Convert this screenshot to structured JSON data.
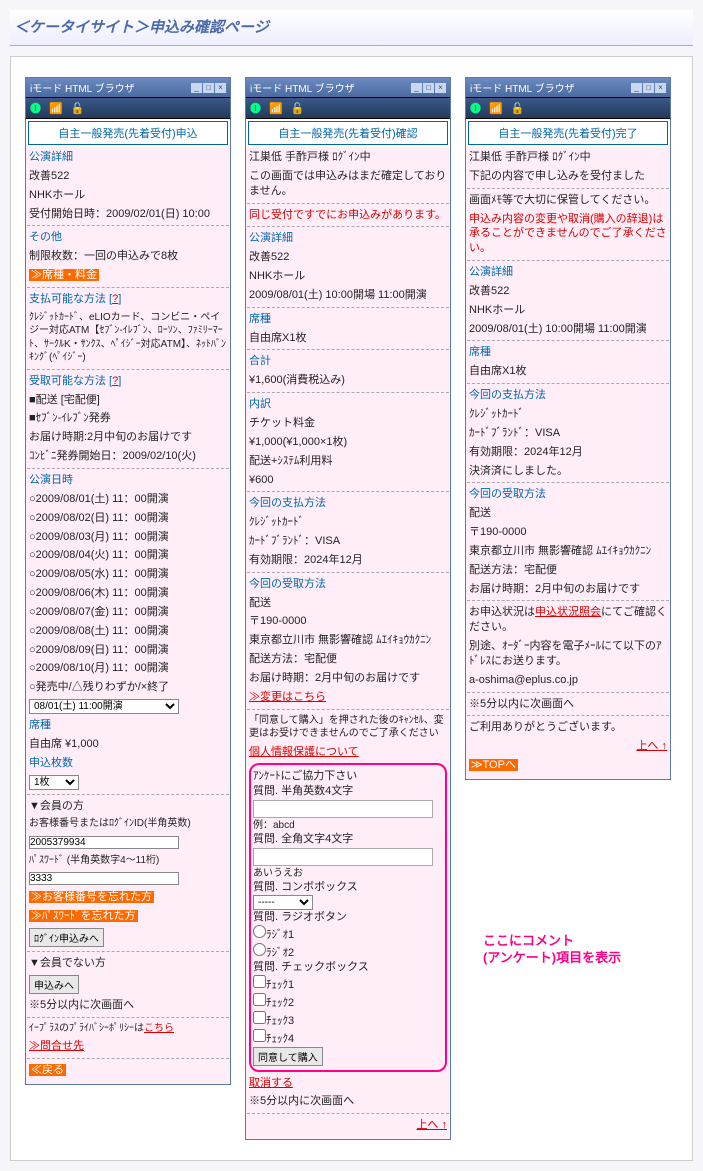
{
  "page_title": "＜ケータイサイト＞申込み確認ページ",
  "titlebar": "iモード HTML ブラウザ",
  "screen1": {
    "header": "自主一般発売(先着受付)申込",
    "s_detail": "公演詳細",
    "title": "改善522",
    "venue": "NHKホール",
    "accept": "受付開始日時：2009/02/01(日) 10:00",
    "s_other": "その他",
    "limit": "制限枚数：一回の申込みで8枚",
    "seat_fee": "≫席種・料金",
    "s_pay": "支払可能な方法 [",
    "q1": "?",
    "pay_text": "ｸﾚｼﾞｯﾄｶｰﾄﾞ、eLIOカード、コンビニ・ペイジー対応ATM【ｾﾌﾞﾝ-ｲﾚﾌﾞﾝ、ﾛｰｿﾝ、ﾌｧﾐﾘｰﾏｰﾄ、ｻｰｸﾙK・ｻﾝｸｽ、ﾍﾟｲｼﾞｰ対応ATM】、ﾈｯﾄﾊﾞﾝｷﾝｸﾞ(ﾍﾟｲｼﾞｰ)",
    "s_recv": "受取可能な方法 [",
    "q2": "?",
    "recv1": "■配送 [宅配便]",
    "recv2": "■ｾﾌﾞﾝ-ｲﾚﾌﾞﾝ発券",
    "recv3": "お届け時期:2月中旬のお届けです",
    "recv4": "ｺﾝﾋﾞﾆ発券開始日：2009/02/10(火)",
    "s_sched": "公演日時",
    "d1": "○2009/08/01(土) 11：00開演",
    "d2": "○2009/08/02(日) 11：00開演",
    "d3": "○2009/08/03(月) 11：00開演",
    "d4": "○2009/08/04(火) 11：00開演",
    "d5": "○2009/08/05(水) 11：00開演",
    "d6": "○2009/08/06(木) 11：00開演",
    "d7": "○2009/08/07(金) 11：00開演",
    "d8": "○2009/08/08(土) 11：00開演",
    "d9": "○2009/08/09(日) 11：00開演",
    "d10": "○2009/08/10(月) 11：00開演",
    "status": "○発売中/△残りわずか/×終了",
    "sel_date": "08/01(土) 11:00開演",
    "s_seat": "席種",
    "seat_price": "自由席 ¥1,000",
    "s_qty": "申込枚数",
    "sel_qty": "1枚",
    "s_member": "▼会員の方",
    "member_label": "お客様番号またはﾛｸﾞｲﾝID(半角英数)",
    "member_val": "2005379934",
    "pw_label": "ﾊﾟｽﾜｰﾄﾞ (半角英数字4～11桁)",
    "pw_val": "3333",
    "forgot1": "≫お客様番号を忘れた方",
    "forgot2": "≫ﾊﾟｽﾜｰﾄﾞを忘れた方",
    "btn_login": "ﾛｸﾞｲﾝ申込みへ",
    "s_nonmember": "▼会員でない方",
    "btn_apply": "申込みへ",
    "note5": "※5分以内に次画面へ",
    "privacy": "ｲｰﾌﾟﾗｽのﾌﾟﾗｲﾊﾞｼｰﾎﾟﾘｼｰは",
    "kochira": "こちら",
    "contact": "≫問合せ先",
    "back": "≪戻る"
  },
  "screen2": {
    "header": "自主一般発売(先着受付)確認",
    "login": "江巣低 手酢戸様 ﾛｸﾞｲﾝ中",
    "warn": "この画面では申込みはまだ確定しておりません。",
    "dup": "同じ受付ですでにお申込みがあります。",
    "s_detail": "公演詳細",
    "title": "改善522",
    "venue": "NHKホール",
    "date": "2009/08/01(土) 10:00開場 11:00開演",
    "s_seat": "席種",
    "seat": "自由席X1枚",
    "s_total": "合計",
    "total": "¥1,600(消費税込み)",
    "s_break": "内訳",
    "break1": "チケット料金",
    "break2": "¥1,000(¥1,000×1枚)",
    "break3": "配送+ｼｽﾃﾑ利用料",
    "break4": "¥600",
    "s_pay": "今回の支払方法",
    "pay1": "ｸﾚｼﾞｯﾄｶｰﾄﾞ",
    "pay2": "ｶｰﾄﾞﾌﾞﾗﾝﾄﾞ：VISA",
    "pay3": "有効期限：2024年12月",
    "s_recv": "今回の受取方法",
    "recv1": "配送",
    "recv2": "〒190-0000",
    "recv3": "東京都立川市 無影響確認 ﾑｴｲｷｮｳｶｸﾆﾝ",
    "recv4": "配送方法：宅配便",
    "recv5": "お届け時期：2月中旬のお届けです",
    "change": "≫変更はこちら",
    "agree1": "「同意して購入」を押された後のｷｬﾝｾﾙ、変更はお受けできませんのでご了承ください",
    "privpol": "個人情報保護について",
    "sv_head": "ｱﾝｹｰﾄにご協力下さい",
    "sv_q1": "質問. 半角英数4文字",
    "sv_ex1": "例：abcd",
    "sv_q2": "質問. 全角文字4文字",
    "sv_ex2": "あいうえお",
    "sv_q3": "質問. コンボボックス",
    "sv_sel": "-----",
    "sv_q4": "質問. ラジオボタン",
    "sv_r1": "ﾗｼﾞｵ1",
    "sv_r2": "ﾗｼﾞｵ2",
    "sv_q5": "質問. チェックボックス",
    "sv_c1": "ﾁｪｯｸ1",
    "sv_c2": "ﾁｪｯｸ2",
    "sv_c3": "ﾁｪｯｸ3",
    "sv_c4": "ﾁｪｯｸ4",
    "btn_agree": "同意して購入",
    "cancel": "取消する",
    "note5": "※5分以内に次画面へ",
    "up": "上へ ↑"
  },
  "screen3": {
    "header": "自主一般発売(先着受付)完了",
    "login": "江巣低 手酢戸様 ﾛｸﾞｲﾝ中",
    "msg1": "下記の内容で申し込みを受付ました",
    "msg2": "画面ﾒﾓ等で大切に保管してください。",
    "msg3": "申込み内容の変更や取消(購入の辞退)は承ることができませんのでご了承ください。",
    "s_detail": "公演詳細",
    "title": "改善522",
    "venue": "NHKホール",
    "date": "2009/08/01(土) 10:00開場 11:00開演",
    "s_seat": "席種",
    "seat": "自由席X1枚",
    "s_pay": "今回の支払方法",
    "pay1": "ｸﾚｼﾞｯﾄｶｰﾄﾞ",
    "pay2": "ｶｰﾄﾞﾌﾞﾗﾝﾄﾞ：VISA",
    "pay3": "有効期限：2024年12月",
    "pay4": "決済済にしました。",
    "s_recv": "今回の受取方法",
    "recv1": "配送",
    "recv2": "〒190-0000",
    "recv3": "東京都立川市 無影響確認 ﾑｴｲｷｮｳｶｸﾆﾝ",
    "recv4": "配送方法：宅配便",
    "recv5": "お届け時期：2月中旬のお届けです",
    "stat1": "お申込状況は",
    "stat2": "申込状況照会",
    "stat3": "にてご確認ください。",
    "stat4": "別途、ｵｰﾀﾞｰ内容を電子ﾒｰﾙにて以下のｱﾄﾞﾚｽにお送ります。",
    "email": "a-oshima@eplus.co.jp",
    "note5": "※5分以内に次画面へ",
    "thanks": "ご利用ありがとうございます。",
    "up": "上へ ↑",
    "top": "≫TOPへ"
  },
  "annotation1": "ここにコメント",
  "annotation2": "(アンケート)項目を表示"
}
